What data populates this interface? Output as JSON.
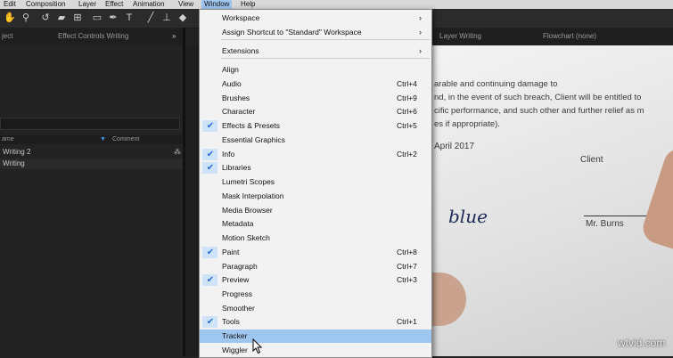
{
  "menubar": {
    "items": [
      "Edit",
      "Composition",
      "Layer",
      "Effect",
      "Animation",
      "View",
      "Window",
      "Help"
    ],
    "active": "Window"
  },
  "panels": {
    "project_tab": "ject",
    "effect_controls_tab": "Effect Controls Writing",
    "layer_tab": "Layer Writing",
    "flowchart_tab": "Flowchart (none)"
  },
  "project": {
    "col_name": "ame",
    "col_comment": "Comment",
    "rows": [
      "Writing 2",
      "Writing"
    ]
  },
  "document": {
    "lines": [
      "arable and continuing damage to",
      "nd, in the event of such breach, Client will be entitled to",
      "cific performance, and such other and further relief as m",
      "es if appropriate)."
    ],
    "date": "April 2017",
    "client_label": "Client",
    "signature": "blue",
    "signer": "Mr. Burns"
  },
  "window_menu": {
    "items": [
      {
        "label": "Workspace",
        "submenu": true
      },
      {
        "label": "Assign Shortcut to \"Standard\" Workspace",
        "submenu": true
      },
      {
        "label": "Extensions",
        "submenu": true
      },
      {
        "label": "Align"
      },
      {
        "label": "Audio",
        "shortcut": "Ctrl+4"
      },
      {
        "label": "Brushes",
        "shortcut": "Ctrl+9"
      },
      {
        "label": "Character",
        "shortcut": "Ctrl+6"
      },
      {
        "label": "Effects & Presets",
        "shortcut": "Ctrl+5",
        "checked": true
      },
      {
        "label": "Essential Graphics"
      },
      {
        "label": "Info",
        "shortcut": "Ctrl+2",
        "checked": true
      },
      {
        "label": "Libraries",
        "checked": true
      },
      {
        "label": "Lumetri Scopes"
      },
      {
        "label": "Mask Interpolation"
      },
      {
        "label": "Media Browser"
      },
      {
        "label": "Metadata"
      },
      {
        "label": "Motion Sketch"
      },
      {
        "label": "Paint",
        "shortcut": "Ctrl+8",
        "checked": true
      },
      {
        "label": "Paragraph",
        "shortcut": "Ctrl+7"
      },
      {
        "label": "Preview",
        "shortcut": "Ctrl+3",
        "checked": true
      },
      {
        "label": "Progress"
      },
      {
        "label": "Smoother"
      },
      {
        "label": "Tools",
        "shortcut": "Ctrl+1",
        "checked": true
      },
      {
        "label": "Tracker",
        "highlighted": true
      },
      {
        "label": "Wiggler"
      }
    ]
  },
  "watermark": "wtvid.com",
  "colors": {
    "menu_highlight": "#9fc6ef",
    "check_color": "#2a6fc9",
    "panel_bg": "#232323"
  }
}
